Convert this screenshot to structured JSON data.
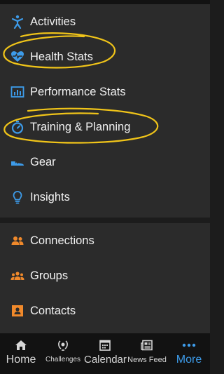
{
  "colors": {
    "background": "#1c1c1c",
    "panel": "#2b2b2b",
    "tabbar": "#121212",
    "blue_icon": "#3d9be9",
    "orange_icon": "#f0892b",
    "active_tab": "#3d9be9",
    "annotation_yellow": "#f0c419"
  },
  "menu": {
    "items": [
      {
        "label": "Activities",
        "icon": "person-running-icon"
      },
      {
        "label": "Health Stats",
        "icon": "heart-pulse-icon"
      },
      {
        "label": "Performance Stats",
        "icon": "bar-chart-icon"
      },
      {
        "label": "Training & Planning",
        "icon": "stopwatch-icon"
      },
      {
        "label": "Gear",
        "icon": "shoe-icon"
      },
      {
        "label": "Insights",
        "icon": "lightbulb-icon"
      }
    ],
    "social": [
      {
        "label": "Connections",
        "icon": "people-icon"
      },
      {
        "label": "Groups",
        "icon": "group-icon"
      },
      {
        "label": "Contacts",
        "icon": "contact-card-icon"
      }
    ]
  },
  "tabbar": {
    "tabs": [
      {
        "label": "Home",
        "icon": "house-icon"
      },
      {
        "label": "Challenges",
        "icon": "laurel-icon"
      },
      {
        "label": "Calendar",
        "icon": "calendar-icon"
      },
      {
        "label": "News Feed",
        "icon": "newspaper-icon"
      },
      {
        "label": "More",
        "icon": "more-dots-icon",
        "active": true
      }
    ]
  }
}
